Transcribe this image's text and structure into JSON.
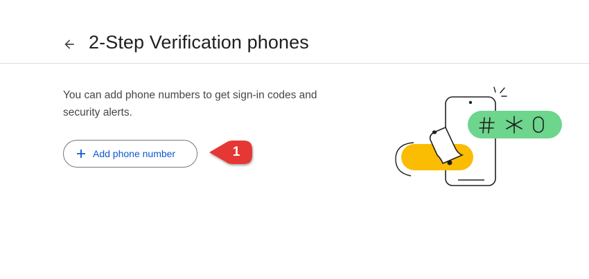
{
  "header": {
    "title": "2-Step Verification phones",
    "back_icon": "arrow-back-icon"
  },
  "main": {
    "description": "You can add phone numbers to get sign-in codes and security alerts.",
    "add_button_label": "Add phone number",
    "add_button_icon": "plus-icon"
  },
  "annotation": {
    "step_number": "1",
    "color": "#e53935"
  },
  "illustration": {
    "code_text": "# ✱ 0",
    "colors": {
      "yellow": "#fbbc04",
      "green": "#6dd58c",
      "outline": "#1f1f1f"
    }
  },
  "colors": {
    "accent": "#0b57d0",
    "text": "#1f1f1f",
    "secondary_text": "#444746",
    "divider": "#dadce0"
  }
}
